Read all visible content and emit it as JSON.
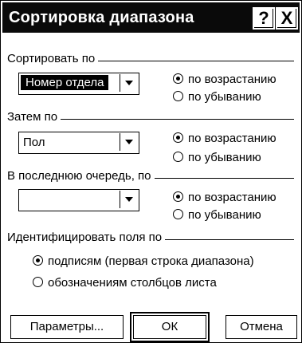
{
  "dialog": {
    "title": "Сортировка диапазона",
    "help_button": "?",
    "close_button": "X"
  },
  "sort_by": {
    "label": "Сортировать по",
    "field_value": "Номер отдела",
    "asc_label": "по возрастанию",
    "desc_label": "по убыванию",
    "selected": "asc"
  },
  "then_by": {
    "label": "Затем по",
    "field_value": "Пол",
    "asc_label": "по возрастанию",
    "desc_label": "по убыванию",
    "selected": "asc"
  },
  "last_by": {
    "label": "В последнюю очередь, по",
    "field_value": "",
    "asc_label": "по возрастанию",
    "desc_label": "по убыванию",
    "selected": "asc"
  },
  "identify": {
    "label": "Идентифицировать поля по",
    "option_headers": "подписям (первая строка диапазона)",
    "option_columns": "обозначениям столбцов листа",
    "selected": "headers"
  },
  "buttons": {
    "options": "Параметры...",
    "ok": "ОК",
    "cancel": "Отмена"
  }
}
